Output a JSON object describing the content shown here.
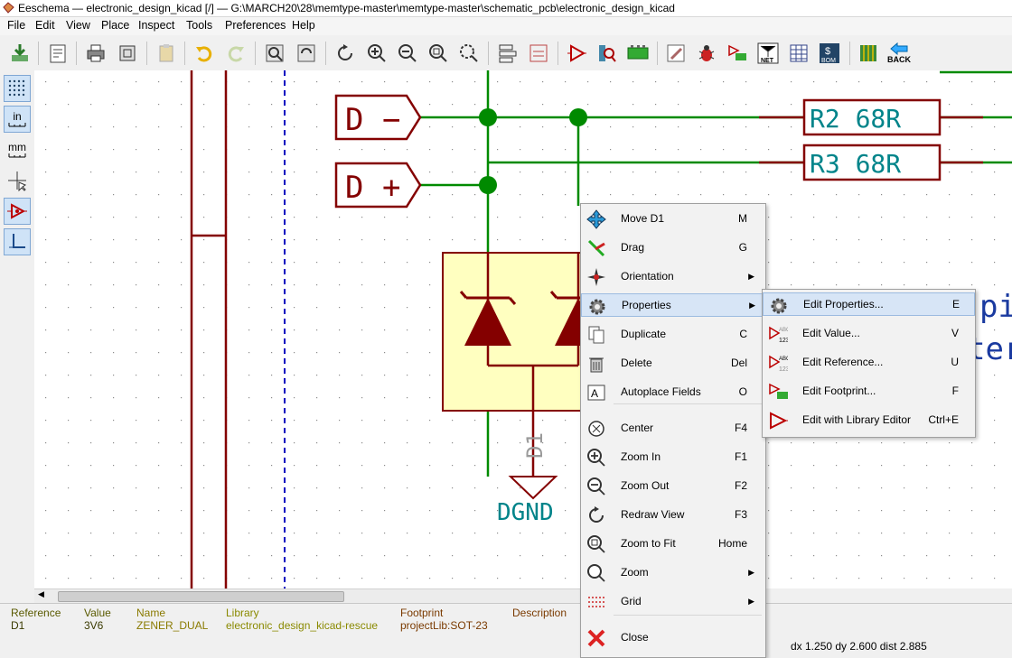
{
  "window": {
    "title": "Eeschema — electronic_design_kicad [/] — G:\\MARCH20\\28\\memtype-master\\memtype-master\\schematic_pcb\\electronic_design_kicad"
  },
  "menubar": [
    "File",
    "Edit",
    "View",
    "Place",
    "Inspect",
    "Tools",
    "Preferences",
    "Help"
  ],
  "toolbar": {
    "net_label": "NET",
    "bom_label": "BOM",
    "back_label": "BACK"
  },
  "left_toolbar": {
    "unit_in": "in",
    "unit_mm": "mm"
  },
  "schematic": {
    "label_dminus": "D −",
    "label_dplus": "D +",
    "r2": "R2  68R",
    "r3": "R3  68R",
    "d1_ref": "D1",
    "dgnd": "DGND",
    "partial_text_1": "pir",
    "partial_text_2": "tern"
  },
  "context_menu": {
    "items": [
      {
        "label": "Move D1",
        "shortcut": "M",
        "icon": "move-icon"
      },
      {
        "label": "Drag",
        "shortcut": "G",
        "icon": "drag-icon"
      },
      {
        "label": "Orientation",
        "shortcut": "",
        "icon": "orientation-icon",
        "submenu": true
      },
      {
        "label": "Properties",
        "shortcut": "",
        "icon": "gear-icon",
        "submenu": true,
        "highlighted": true
      },
      {
        "label": "Duplicate",
        "shortcut": "C",
        "icon": "duplicate-icon"
      },
      {
        "label": "Delete",
        "shortcut": "Del",
        "icon": "trash-icon"
      },
      {
        "label": "Autoplace Fields",
        "shortcut": "O",
        "icon": "autoplace-icon"
      },
      {
        "label": "Center",
        "shortcut": "F4",
        "icon": "center-icon"
      },
      {
        "label": "Zoom In",
        "shortcut": "F1",
        "icon": "zoom-in-icon"
      },
      {
        "label": "Zoom Out",
        "shortcut": "F2",
        "icon": "zoom-out-icon"
      },
      {
        "label": "Redraw View",
        "shortcut": "F3",
        "icon": "redraw-icon"
      },
      {
        "label": "Zoom to Fit",
        "shortcut": "Home",
        "icon": "zoom-fit-icon"
      },
      {
        "label": "Zoom",
        "shortcut": "",
        "icon": "zoom-icon",
        "submenu": true
      },
      {
        "label": "Grid",
        "shortcut": "",
        "icon": "grid-icon",
        "submenu": true
      },
      {
        "label": "Close",
        "shortcut": "",
        "icon": "close-icon"
      }
    ]
  },
  "submenu": {
    "items": [
      {
        "label": "Edit Properties...",
        "shortcut": "E",
        "icon": "gear-icon",
        "highlighted": true
      },
      {
        "label": "Edit Value...",
        "shortcut": "V",
        "icon": "edit-value-icon"
      },
      {
        "label": "Edit Reference...",
        "shortcut": "U",
        "icon": "edit-reference-icon"
      },
      {
        "label": "Edit Footprint...",
        "shortcut": "F",
        "icon": "edit-footprint-icon"
      },
      {
        "label": "Edit with Library Editor",
        "shortcut": "Ctrl+E",
        "icon": "library-editor-icon"
      }
    ]
  },
  "statusbar": {
    "reference_h": "Reference",
    "reference_v": "D1",
    "value_h": "Value",
    "value_v": "3V6",
    "name_h": "Name",
    "name_v": "ZENER_DUAL",
    "library_h": "Library",
    "library_v": "electronic_design_kicad-rescue",
    "footprint_h": "Footprint",
    "footprint_v": "projectLib:SOT-23",
    "description_h": "Description",
    "coords": "dx 1.250  dy 2.600  dist 2.885"
  },
  "colors": {
    "wire": "#008a00",
    "component": "#840000",
    "canvas_bg": "#ffffff",
    "label_teal": "#00848a",
    "highlight": "#d7e5f6"
  }
}
